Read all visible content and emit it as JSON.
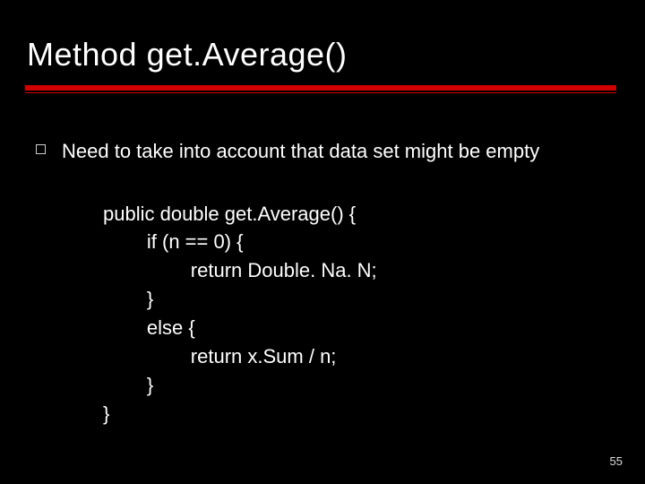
{
  "title": "Method get.Average()",
  "bullet": "Need to take into account that data set might be empty",
  "code": {
    "l1": "public double get.Average() {",
    "l2": "        if (n == 0) {",
    "l3": "                return Double. Na. N;",
    "l4": "        }",
    "l5": "        else {",
    "l6": "                return x.Sum / n;",
    "l7": "        }",
    "l8": "}"
  },
  "page_number": "55"
}
